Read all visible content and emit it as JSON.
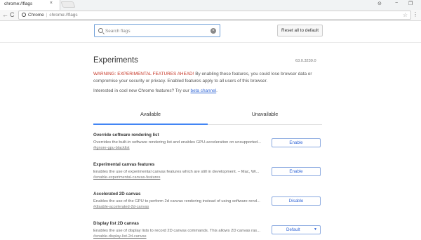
{
  "browser": {
    "tab_title": "chrome://flags",
    "tab_close": "×",
    "chip_label": "Chrome",
    "url": "chrome://flags",
    "back": "←",
    "forward": "→",
    "reload": "C",
    "star": "☆",
    "menu": "⋮",
    "window_controls": {
      "user": "⊝",
      "minimize": "−",
      "maximize": "❐"
    }
  },
  "search": {
    "placeholder": "Search flags",
    "clear": "×"
  },
  "reset_label": "Reset all to default",
  "page": {
    "title": "Experiments",
    "version": "63.0.3239.0",
    "warning_strong": "WARNING: EXPERIMENTAL FEATURES AHEAD!",
    "warning_rest": " By enabling these features, you could lose browser data or compromise your security or privacy. Enabled features apply to all users of this browser.",
    "interested_prefix": "Interested in cool new Chrome features? Try our ",
    "beta_link": "beta channel",
    "interested_suffix": "."
  },
  "tabs": [
    {
      "label": "Available",
      "active": true
    },
    {
      "label": "Unavailable",
      "active": false
    }
  ],
  "experiments": [
    {
      "title": "Override software rendering list",
      "desc": "Overrides the built-in software rendering list and enables GPU-acceleration on unsupported...",
      "id": "#ignore-gpu-blacklist",
      "control": "Enable"
    },
    {
      "title": "Experimental canvas features",
      "desc": "Enables the use of experimental canvas features which are still in development. – Mac, Wi...",
      "id": "#enable-experimental-canvas-features",
      "control": "Enable"
    },
    {
      "title": "Accelerated 2D canvas",
      "desc": "Enables the use of the GPU to perform 2d canvas rendering instead of using software rend...",
      "id": "#disable-accelerated-2d-canvas",
      "control": "Disable"
    },
    {
      "title": "Display list 2D canvas",
      "desc": "Enables the use of display lists to record 2D canvas commands. This allows 2D canvas ras...",
      "id": "#enable-display-list-2d-canvas",
      "control": "Default",
      "caret": "▼"
    }
  ]
}
